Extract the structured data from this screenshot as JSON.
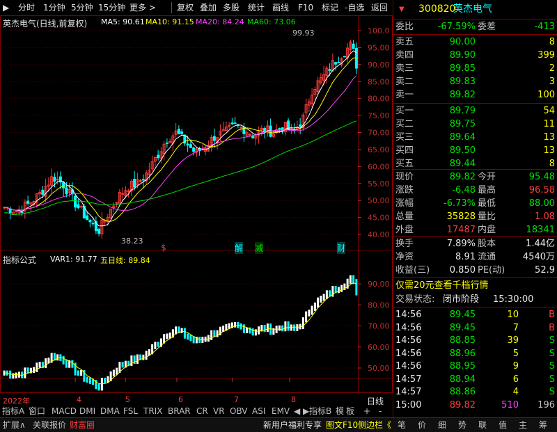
{
  "toolbar": {
    "items": [
      "分时",
      "1分钟",
      "5分钟",
      "15分钟",
      "更多 >",
      "复权",
      "叠加",
      "多股",
      "统计",
      "画线",
      "F10",
      "标记",
      "-自选",
      "返回"
    ]
  },
  "main_chart": {
    "legend_title": "英杰电气(日线,前复权)",
    "ma5": "MA5: 90.61",
    "ma10": "MA10: 91.15",
    "ma20": "MA20: 84.24",
    "ma60": "MA60: 73.06",
    "high_label": "99.93",
    "low_label": "38.23",
    "yaxis": [
      "100.0",
      "95.00",
      "90.00",
      "85.00",
      "80.00",
      "75.00",
      "70.00",
      "65.00",
      "60.00",
      "55.00",
      "50.00",
      "45.00",
      "40.00"
    ],
    "markers": {
      "s": "$",
      "jie": "解",
      "jian": "减",
      "cai": "财"
    }
  },
  "indicator": {
    "title": "指标公式",
    "var1": "VAR1: 91.77",
    "five_day": "五日线: 89.84",
    "yaxis": [
      "90.00",
      "80.00",
      "70.00",
      "60.00",
      "50.00"
    ]
  },
  "xaxis": {
    "labels": [
      "2022年",
      "4",
      "5",
      "6",
      "7",
      "8"
    ],
    "right_label": "日线"
  },
  "tabs": {
    "items": [
      "指标A",
      "窗口",
      "MACD",
      "DMI",
      "DMA",
      "FSL",
      "TRIX",
      "BRAR",
      "CR",
      "VR",
      "OBV",
      "ASI",
      "EMV"
    ],
    "right_items": [
      "指标B",
      "模",
      "板",
      "+",
      "-"
    ]
  },
  "status": {
    "left": [
      "扩展∧",
      "关联报价",
      "财富圈"
    ],
    "mid": [
      "新用户福利专享",
      "图文F10",
      "侧边栏《"
    ],
    "right": [
      "笔",
      "价",
      "细",
      "势",
      "联",
      "值",
      "主",
      "筹"
    ]
  },
  "quote": {
    "code": "300820",
    "name": "英杰电气",
    "weibi_label": "委比",
    "weibi_value": "-67.59%",
    "weicha_label": "委差",
    "weicha_value": "-413",
    "sell": [
      {
        "label": "卖五",
        "price": "90.00",
        "vol": "8"
      },
      {
        "label": "卖四",
        "price": "89.90",
        "vol": "399"
      },
      {
        "label": "卖三",
        "price": "89.85",
        "vol": "2"
      },
      {
        "label": "卖二",
        "price": "89.83",
        "vol": "3"
      },
      {
        "label": "卖一",
        "price": "89.82",
        "vol": "100"
      }
    ],
    "buy": [
      {
        "label": "买一",
        "price": "89.79",
        "vol": "54"
      },
      {
        "label": "买二",
        "price": "89.75",
        "vol": "11"
      },
      {
        "label": "买三",
        "price": "89.64",
        "vol": "13"
      },
      {
        "label": "买四",
        "price": "89.50",
        "vol": "13"
      },
      {
        "label": "买五",
        "price": "89.44",
        "vol": "8"
      }
    ],
    "stats": [
      {
        "l1": "现价",
        "v1": "89.82",
        "l2": "今开",
        "v2": "95.48"
      },
      {
        "l1": "涨跌",
        "v1": "-6.48",
        "l2": "最高",
        "v2": "96.58"
      },
      {
        "l1": "涨幅",
        "v1": "-6.73%",
        "l2": "最低",
        "v2": "88.00"
      },
      {
        "l1": "总量",
        "v1": "35828",
        "l2": "量比",
        "v2": "1.08"
      },
      {
        "l1": "外盘",
        "v1": "17487",
        "l2": "内盘",
        "v2": "18341"
      }
    ],
    "fund": [
      {
        "l1": "换手",
        "v1": "7.89%",
        "l2": "股本",
        "v2": "1.44亿"
      },
      {
        "l1": "净资",
        "v1": "8.91",
        "l2": "流通",
        "v2": "4540万"
      },
      {
        "l1": "收益(三)",
        "v1": "0.850",
        "l2": "PE(动)",
        "v2": "52.9"
      }
    ],
    "promo": "仅需20元查看千档行情",
    "trade_state_label": "交易状态:",
    "trade_state": "闭市阶段",
    "trade_time": "15:30:00",
    "ticks": [
      {
        "t": "14:56",
        "p": "89.45",
        "v": "10",
        "d": "B"
      },
      {
        "t": "14:56",
        "p": "89.45",
        "v": "7",
        "d": "B"
      },
      {
        "t": "14:56",
        "p": "88.85",
        "v": "39",
        "d": "S"
      },
      {
        "t": "14:56",
        "p": "88.96",
        "v": "5",
        "d": "S"
      },
      {
        "t": "14:56",
        "p": "88.95",
        "v": "9",
        "d": "S"
      },
      {
        "t": "14:57",
        "p": "88.94",
        "v": "6",
        "d": "S"
      },
      {
        "t": "14:57",
        "p": "88.86",
        "v": "4",
        "d": "S"
      },
      {
        "t": "15:00",
        "p": "89.82",
        "v": "510",
        "d": "196"
      }
    ]
  }
}
